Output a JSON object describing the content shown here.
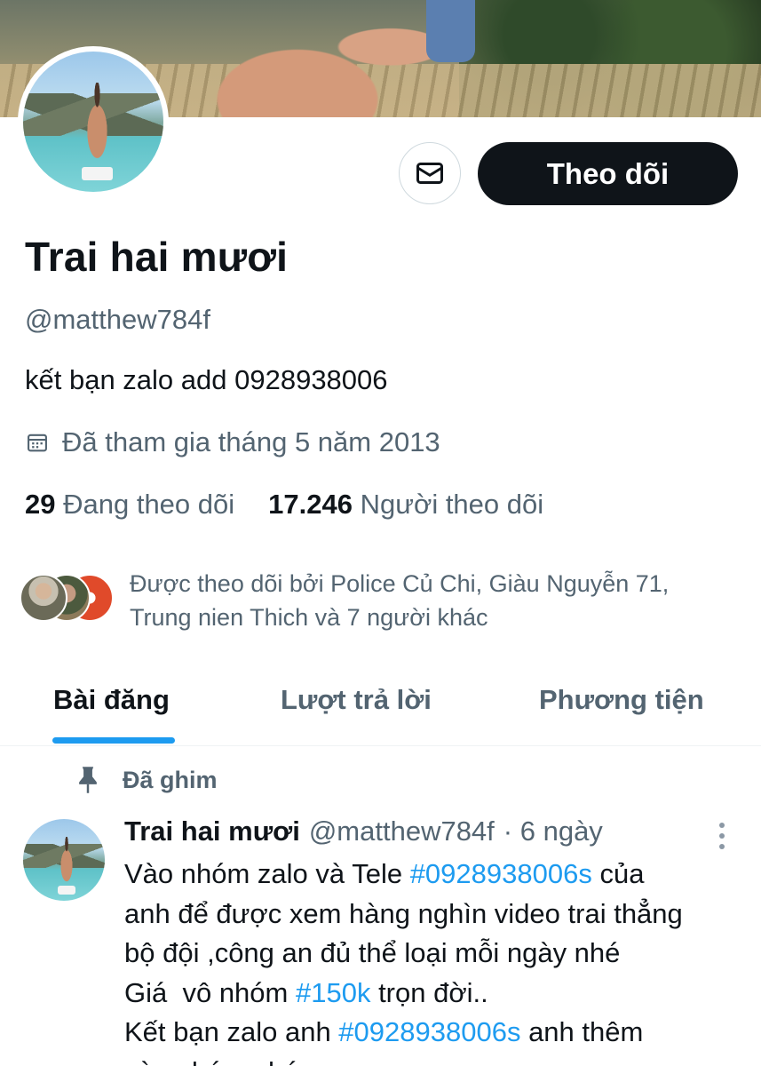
{
  "profile": {
    "name": "Trai hai mươi",
    "handle": "@matthew784f",
    "bio": "kết bạn zalo add 0928938006",
    "joined": "Đã tham gia tháng 5 năm 2013",
    "following_count": "29",
    "following_label": "Đang theo dõi",
    "followers_count": "17.246",
    "followers_label": "Người theo dõi",
    "followed_by_line1": "Được theo dõi bởi Police Củ Chi, Giàu Nguyễn 71,",
    "followed_by_line2": "Trung nien Thich và 7 người khác"
  },
  "actions": {
    "follow_label": "Theo dõi"
  },
  "tabs": [
    {
      "label": "Bài đăng",
      "active": true
    },
    {
      "label": "Lượt trả lời",
      "active": false
    },
    {
      "label": "Phương tiện",
      "active": false
    }
  ],
  "pinned_label": "Đã ghim",
  "post": {
    "author": "Trai hai mươi",
    "handle": "@matthew784f",
    "time": "· 6 ngày",
    "l1_a": "Vào nhóm zalo và Tele ",
    "l1_tag": "#0928938006s",
    "l1_b": " của",
    "l2": "anh để được xem hàng nghìn video trai thẳng",
    "l3": "bộ đội ,công an đủ thể loại mỗi ngày nhé",
    "l4_a": "Giá  vô nhóm ",
    "l4_tag": "#150k",
    "l4_b": " trọn đời..",
    "l5_a": "Kết bạn zalo anh ",
    "l5_tag": "#0928938006s",
    "l5_b": " anh thêm",
    "l6": "vào nhóm nhé"
  },
  "colors": {
    "accent": "#1d9bf0",
    "primary_text": "#0f1419",
    "secondary_text": "#536471",
    "follow_button_bg": "#0f1419"
  }
}
